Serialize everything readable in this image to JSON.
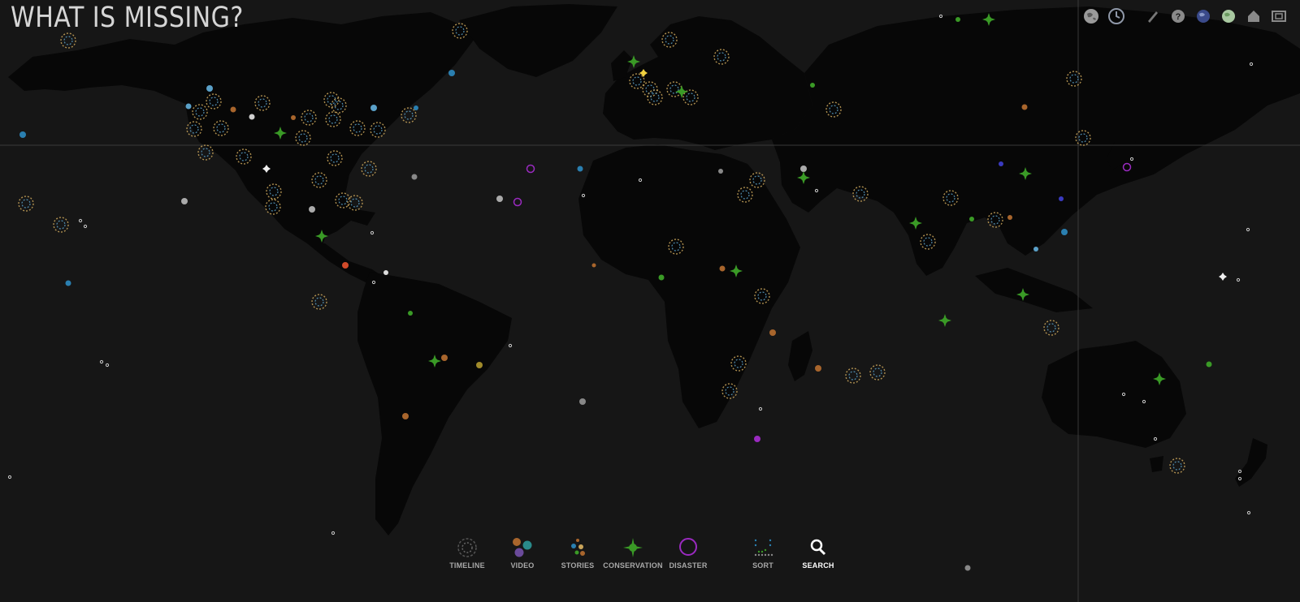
{
  "header": {
    "title": "WHAT IS MISSING?"
  },
  "toolbar": {
    "items": [
      {
        "name": "globe-view-icon",
        "color": "#9a9a9a"
      },
      {
        "name": "clock-icon",
        "color": "#8f98a8"
      },
      {
        "name": "pencil-icon",
        "color": "#777777"
      },
      {
        "name": "help-icon",
        "color": "#8a8a8a"
      },
      {
        "name": "earth-icon",
        "color": "#5f6fa8"
      },
      {
        "name": "earth-green-icon",
        "color": "#a8c8a0"
      },
      {
        "name": "home-icon",
        "color": "#8a8a8a"
      },
      {
        "name": "fullscreen-icon",
        "color": "#8a8a8a"
      }
    ]
  },
  "legend": {
    "items": [
      {
        "key": "timeline",
        "label": "TIMELINE"
      },
      {
        "key": "video",
        "label": "VIDEO"
      },
      {
        "key": "stories",
        "label": "STORIES"
      },
      {
        "key": "conservation",
        "label": "CONSERVATION"
      },
      {
        "key": "disaster",
        "label": "DISASTER"
      },
      {
        "key": "sort",
        "label": "SORT"
      },
      {
        "key": "search",
        "label": "SEARCH",
        "active": true
      }
    ]
  },
  "colors": {
    "background": "#161616",
    "land": "#070707",
    "timeline": "#c9a45a",
    "video_orange": "#a8652c",
    "video_blue": "#2a7fb0",
    "video_purple": "#6a4a9a",
    "conservation": "#3a9a26",
    "disaster": "#9a2ac0",
    "story_white": "#e8e8e8",
    "gridline": "#3a3a3a"
  }
}
